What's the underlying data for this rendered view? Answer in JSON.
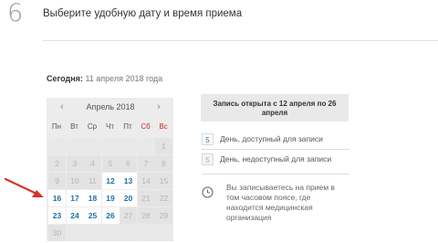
{
  "step": {
    "number": "6",
    "title": "Выберите удобную дату и время приема"
  },
  "today": {
    "label": "Сегодня:",
    "value": "11 апреля 2018 года"
  },
  "calendar": {
    "month_label": "Апрель 2018",
    "prev_icon": "chevron-left-icon",
    "next_icon": "chevron-right-icon",
    "weekdays": [
      "Пн",
      "Вт",
      "Ср",
      "Чт",
      "Пт",
      "Сб",
      "Вс"
    ],
    "weekend_color": "#d0262b",
    "available_color": "#1f6ea8",
    "weeks": [
      [
        "",
        "",
        "",
        "",
        "",
        "",
        "1"
      ],
      [
        "2",
        "3",
        "4",
        "5",
        "6",
        "7",
        "8"
      ],
      [
        "9",
        "10",
        "11",
        "12",
        "13",
        "14",
        "15"
      ],
      [
        "16",
        "17",
        "18",
        "19",
        "20",
        "21",
        "22"
      ],
      [
        "23",
        "24",
        "25",
        "26",
        "27",
        "28",
        "29"
      ],
      [
        "30",
        "",
        "",
        "",
        "",
        "",
        ""
      ]
    ],
    "available_days": [
      "12",
      "13",
      "16",
      "17",
      "18",
      "19",
      "20",
      "23",
      "24",
      "25",
      "26"
    ]
  },
  "booking": {
    "open_text": "Запись открыта с 12 апреля по 26 апреля"
  },
  "legend": {
    "available_sample": "5",
    "available_text": "День, доступный для записи",
    "unavailable_sample": "5",
    "unavailable_text": "День, недоступный для записи"
  },
  "timezone": {
    "icon": "clock-icon",
    "note": "Вы записываетесь на прием в том часовом поясе, где находится медицинская организация"
  },
  "annotation": {
    "arrow_color": "#d8322a"
  }
}
